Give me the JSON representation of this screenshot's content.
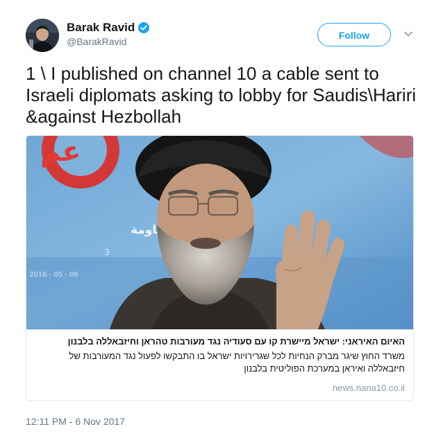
{
  "author": {
    "display_name": "Barak Ravid",
    "handle": "@BarakRavid",
    "verified": true,
    "verified_color": "#1da1f2"
  },
  "follow_button": {
    "label": "Follow",
    "color": "#1da1f2"
  },
  "menu": {
    "icon": "chevron-down-icon"
  },
  "tweet": {
    "text": "1 \\ I published on channel 10 a cable sent to Israeli diplomats asking to lobby for Saudis\\Hariri &against Hezbollah",
    "timestamp": "12:11 PM - 6 Nov 2017"
  },
  "link_card": {
    "image": {
      "backdrop_logo_text": "عم",
      "backdrop_text_line1": "دعم المقاومة",
      "backdrop_text_line2": "3",
      "backdrop_date": "2016 - 05 - 06"
    },
    "title": "האיום האיראני: ישראל מיישרת קו עם סעודיה נגד מעורבות טהראן וחיזבאללה בלבנון",
    "description": "משרד החוץ שיגר מברק הנחיות לכל שגרירויות ישראל בו התבקשו לפעול נגד המעורבות של חיזבאללה ואיראן במערכת הפוליטית בלבנון",
    "domain": "news.nana10.co.il"
  },
  "colors": {
    "text_primary": "#14171a",
    "text_secondary": "#657786",
    "border": "#e1e8ed",
    "accent": "#1da1f2"
  }
}
